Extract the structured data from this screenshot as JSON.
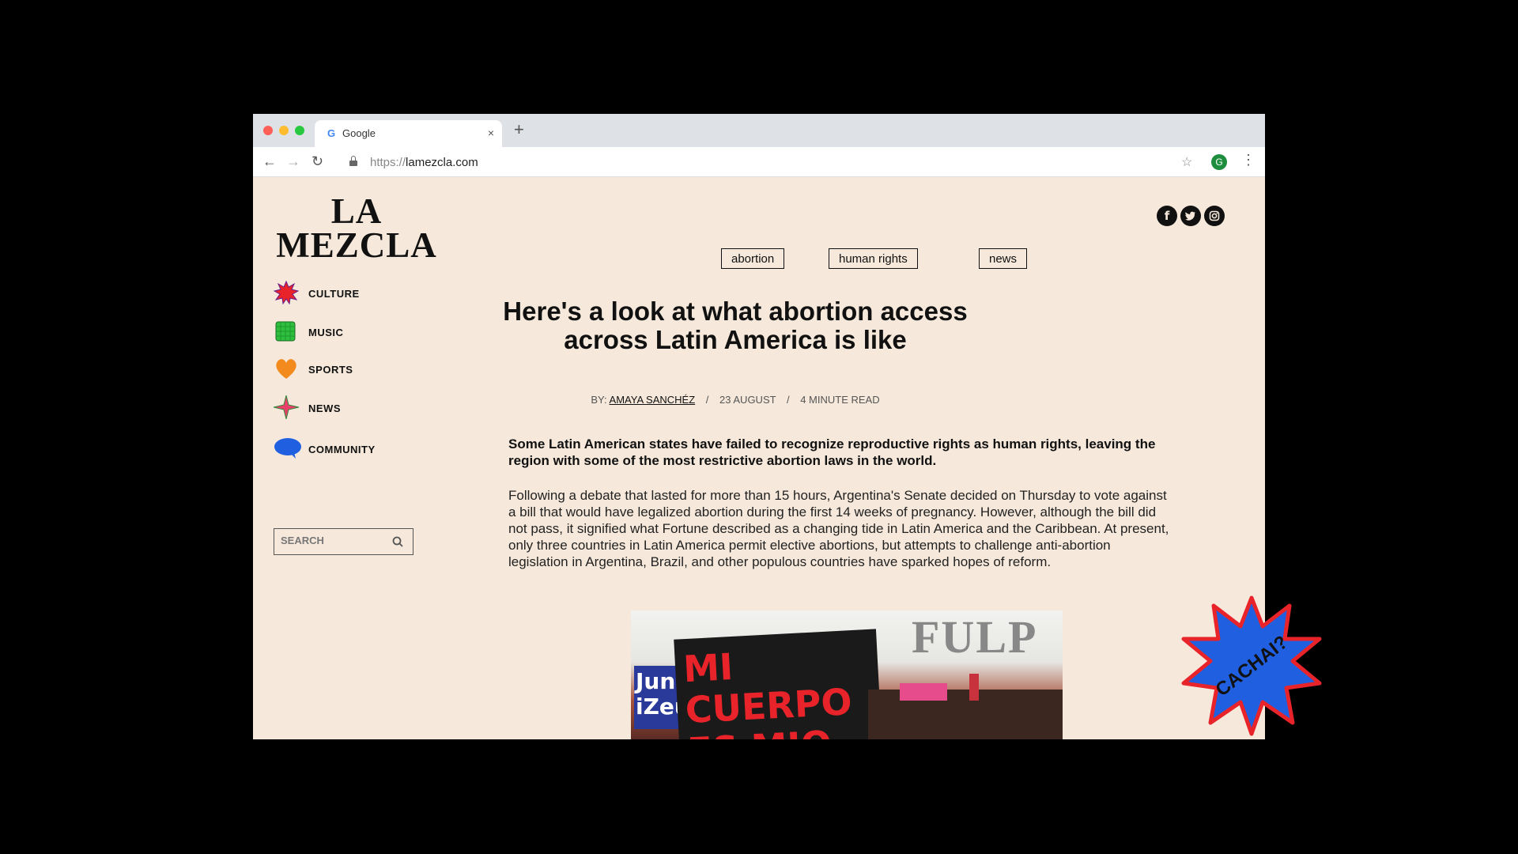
{
  "browser": {
    "tab_title": "Google",
    "tab_icon": "G",
    "url_scheme": "https://",
    "url_host": "lamezcla.com",
    "profile_initial": "G",
    "tab_close_glyph": "×",
    "new_tab_glyph": "+",
    "bookmark_glyph": "☆"
  },
  "site": {
    "logo": "LA MEZCLA",
    "social": [
      "f",
      "t",
      "ig"
    ]
  },
  "sidebar": {
    "items": [
      {
        "label": "CULTURE",
        "icon": "starburst-icon",
        "color": "#e8242a"
      },
      {
        "label": "MUSIC",
        "icon": "grid-square-icon",
        "color": "#2fbf3f"
      },
      {
        "label": "SPORTS",
        "icon": "heart-icon",
        "color": "#f28a1e"
      },
      {
        "label": "NEWS",
        "icon": "sparkle-icon",
        "color": "#e8406a"
      },
      {
        "label": "COMMUNITY",
        "icon": "speech-bubble-icon",
        "color": "#1f5fe0"
      }
    ],
    "search_placeholder": "SEARCH"
  },
  "article": {
    "tags": [
      "abortion",
      "human rights",
      "news"
    ],
    "title": "Here's a look at what abortion access across Latin America is like",
    "byline_prefix": "BY:",
    "author": "AMAYA SANCHÉZ",
    "date": "23 AUGUST",
    "read_time": "4 MINUTE READ",
    "lede": "Some Latin American states have failed to recognize reproductive rights as human rights, leaving the region with some of the most restrictive abortion laws in the world.",
    "body": "Following a debate that lasted for more than 15 hours, Argentina's Senate decided on Thursday to vote against a bill that would have legalized abortion during the first 14 weeks of pregnancy. However, although the bill did not pass, it signified what Fortune described as a changing tide in Latin America and the Caribbean. At present, only three countries in Latin America permit elective abortions, but attempts to challenge anti-abortion legislation in Argentina, Brazil, and other populous countries have sparked hopes of reform.",
    "image_sign_text": "MI CUERPO ES MIO",
    "image_side_sign": "Jun iZeu",
    "image_building_letters": "FULP"
  },
  "sticker": {
    "text": "CACHAI?",
    "fill": "#1f5fe0",
    "stroke": "#e8242a"
  },
  "colors": {
    "page_bg": "#f6e9db",
    "ink": "#111111",
    "outer_bg": "#000000"
  }
}
